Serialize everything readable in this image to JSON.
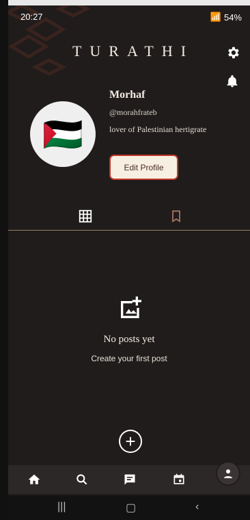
{
  "status": {
    "time": "20:27",
    "battery": "54%"
  },
  "header": {
    "brand": "TURATHI"
  },
  "profile": {
    "avatar_emoji": "🇵🇸",
    "name": "Morhaf",
    "handle": "@morahfrateb",
    "bio": "lover of Palestinian hertigrate",
    "edit_label": "Edit Profile"
  },
  "empty": {
    "title": "No posts yet",
    "subtitle": "Create your first post"
  },
  "colors": {
    "background": "#1f1c1b",
    "accent": "#c0392b",
    "divider": "#9a7d62"
  },
  "icons": {
    "settings": "gear-icon",
    "notifications": "bell-icon",
    "grid": "grid-icon",
    "saved": "bookmark-icon",
    "empty": "add-image-icon",
    "add": "plus-icon",
    "nav": [
      "home-icon",
      "search-icon",
      "chat-icon",
      "calendar-icon",
      "profile-icon"
    ]
  }
}
